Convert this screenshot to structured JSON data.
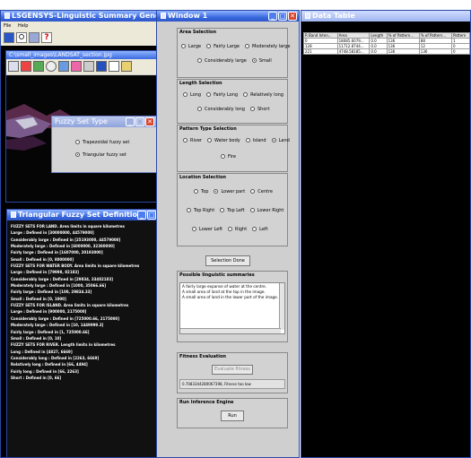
{
  "main_window": {
    "title": "LSGENSYS-Linguistic Summary Generation",
    "menu": [
      "File",
      "Help"
    ],
    "image_window_title": "C:\\small_images\\LANDSAT_section.jpg"
  },
  "fuzzy_set_type": {
    "title": "Fuzzy Set Type",
    "options": [
      "Trapezoidal fuzzy set",
      "Triangular fuzzy set"
    ],
    "selected": "Triangular fuzzy set"
  },
  "definitions": {
    "title": "Triangular Fuzzy Set Definitions",
    "lines": [
      "FUZZY SETS FOR LAND. Area limits in square kilometres",
      "Large : Defined in [30000000, 44579000]",
      "Considerably large : Defined in [25193000, 44579000]",
      "Moderately large : Defined in [6000000, 32380000]",
      "Fairly large : Defined in [1607000, 20193000]",
      "Small : Defined in [0, 8000000]",
      "FUZZY SETS FOR WATER BODY. Area limits in square kilometres",
      "Large : Defined in [79998, 82183]",
      "Considerably large : Defined in [29834, 33482183]",
      "Moderately large : Defined in [1000, 35066.66]",
      "Fairly large : Defined in [100, 29834.33]",
      "Small : Defined in [0, 1000]",
      "FUZZY SETS FOR ISLAND. Area limits in square kilometres",
      "Large : Defined in [900000, 2175000]",
      "Considerably large : Defined in [725000.66, 2175000]",
      "Moderately large : Defined in [10, 1449999.3]",
      "Fairly large : Defined in [1, 725000.66]",
      "Small : Defined in [0, 10]",
      "FUZZY SETS FOR RIVER. Length limits in kilometres",
      "Long : Defined in [4827, 6669]",
      "Considerably long : Defined in [2263, 6669]",
      "Relatively long : Defined in [66, 4494]",
      "Fairly long : Defined in [66, 2263]",
      "Short : Defined in [0, 66]"
    ]
  },
  "window1": {
    "title": "Window 1",
    "area_selection": {
      "title": "Area Selection",
      "options": [
        "Large",
        "Fairly Large",
        "Moderately large",
        "Considerably large",
        "Small"
      ],
      "selected": "Small"
    },
    "length_selection": {
      "title": "Length Selection",
      "options": [
        "Long",
        "Fairly Long",
        "Relatively long",
        "Considerably long",
        "Short"
      ]
    },
    "pattern_type": {
      "title": "Pattern Type Selection",
      "options": [
        "River",
        "Water body",
        "Island",
        "Land",
        "Fire"
      ],
      "selected": "Land"
    },
    "location_selection": {
      "title": "Location Selection",
      "options": [
        "Top",
        "Lower part",
        "Centre",
        "Top Right",
        "Top Left",
        "Lower Right",
        "Lower Left",
        "Right",
        "Left"
      ],
      "selected": "Lower part"
    },
    "selection_done": "Selection Done",
    "summaries": {
      "title": "Possible linguistic summaries",
      "lines": [
        "A fairly large expanse of water at the centre.",
        "A small area of land at the top in the image.",
        "A small area of land in the lower part of the image."
      ]
    },
    "fitness": {
      "title": "Fitness Evaluation",
      "button": "Evaluate fitness",
      "result": "0.7083344280067398, Fitness too low"
    },
    "engine": {
      "title": "Run Inference Engine",
      "button": "Run"
    }
  },
  "data_table": {
    "title": "Data Table",
    "columns": [
      "R Band Inten...",
      "Area",
      "Length",
      "% of Pattern...",
      "% of Pattern...",
      "Pattern"
    ],
    "rows": [
      [
        "0",
        "18085.6079...",
        "0.0",
        "136",
        "88",
        "1"
      ],
      [
        "128",
        "11712.8744...",
        "0.0",
        "136",
        "12",
        "0"
      ],
      [
        "221",
        "4748.58185...",
        "0.0",
        "136",
        "136",
        "0"
      ]
    ]
  }
}
